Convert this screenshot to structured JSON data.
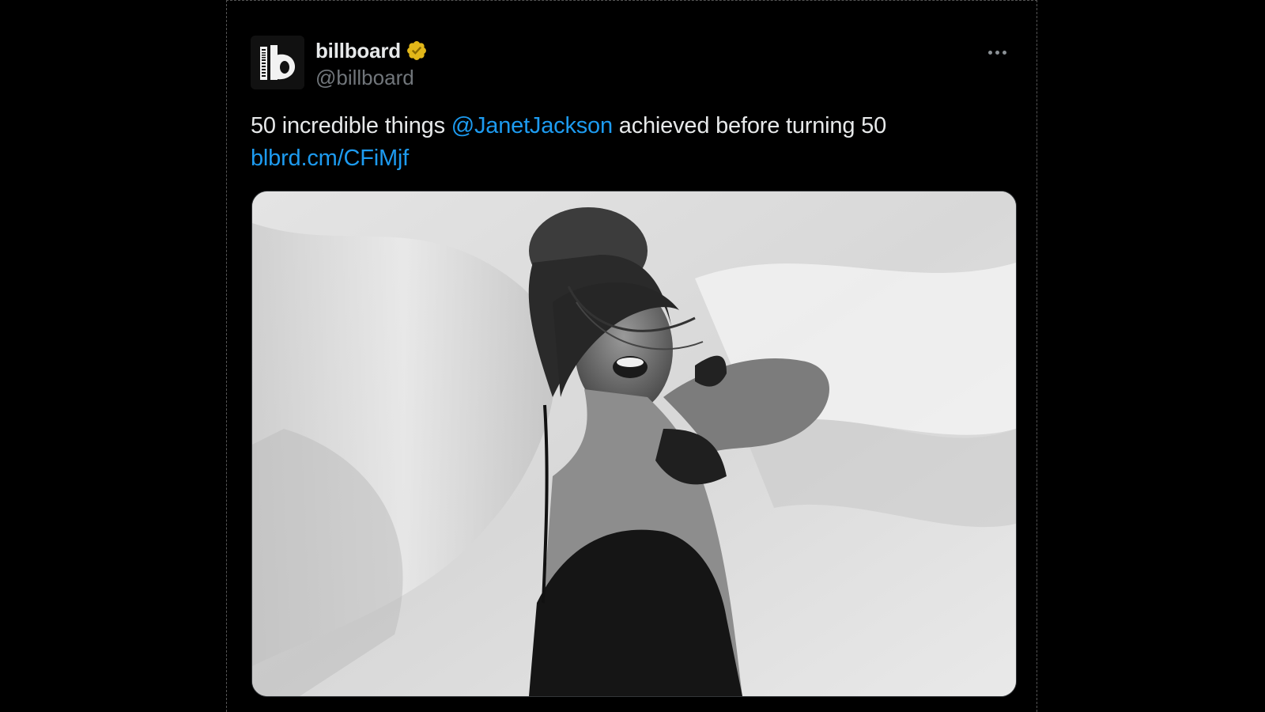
{
  "tweet": {
    "display_name": "billboard",
    "handle": "@billboard",
    "verified_icon": "verified-gold-badge-icon",
    "more_icon": "more-options-icon",
    "text_before_mention": "50 incredible things ",
    "mention": "@JanetJackson",
    "text_after_mention": " achieved before turning 50",
    "link": "blbrd.cm/CFiMjf",
    "media_description_icon": "photo",
    "avatar_logo_text": "billboard",
    "avatar_letter": "b"
  },
  "colors": {
    "background": "#000000",
    "text": "#e7e9ea",
    "secondary": "#71767b",
    "link": "#1d9bf0",
    "verified": "#e2b719"
  }
}
